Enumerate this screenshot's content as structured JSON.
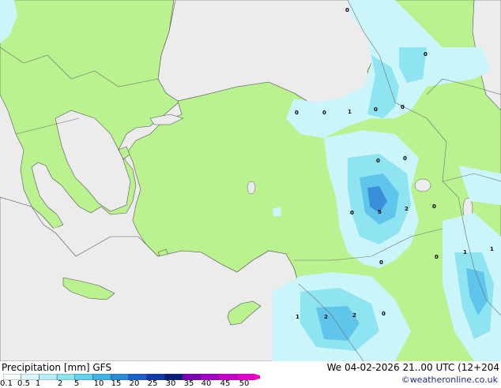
{
  "map": {
    "colors": {
      "sea": "#ececec",
      "land": "#b9f28e",
      "border": "#6e6e6e",
      "precip_light": "#c9f5fb",
      "precip_mid": "#8fe4f2",
      "precip_heavy": "#5fc5ea",
      "precip_core": "#3a8fd8"
    },
    "contour_labels": [
      "0",
      "0",
      "0",
      "1",
      "0",
      "0",
      "0",
      "0",
      "0",
      "5",
      "2",
      "0",
      "0",
      "0",
      "1",
      "1",
      "0",
      "1",
      "2",
      "2",
      "0"
    ]
  },
  "footer": {
    "title": "Precipitation [mm]  GFS",
    "valid_time": "We 04-02-2026 21..00 UTC (12+204",
    "credit": "©weatheronline.co.uk",
    "scale": {
      "labels": [
        "0.1",
        "0.5",
        "1",
        "2",
        "5",
        "10",
        "15",
        "20",
        "25",
        "30",
        "35",
        "40",
        "45",
        "50"
      ],
      "colors": [
        "#f5fcfe",
        "#d8f6fb",
        "#b6edf6",
        "#8fe2f1",
        "#63d0ec",
        "#3fb4e4",
        "#2b8bd8",
        "#1d5fc8",
        "#123aa6",
        "#0a1f7a",
        "#7a00b4",
        "#a400c8",
        "#c800cc",
        "#e000d0",
        "#ff00cc"
      ]
    }
  }
}
